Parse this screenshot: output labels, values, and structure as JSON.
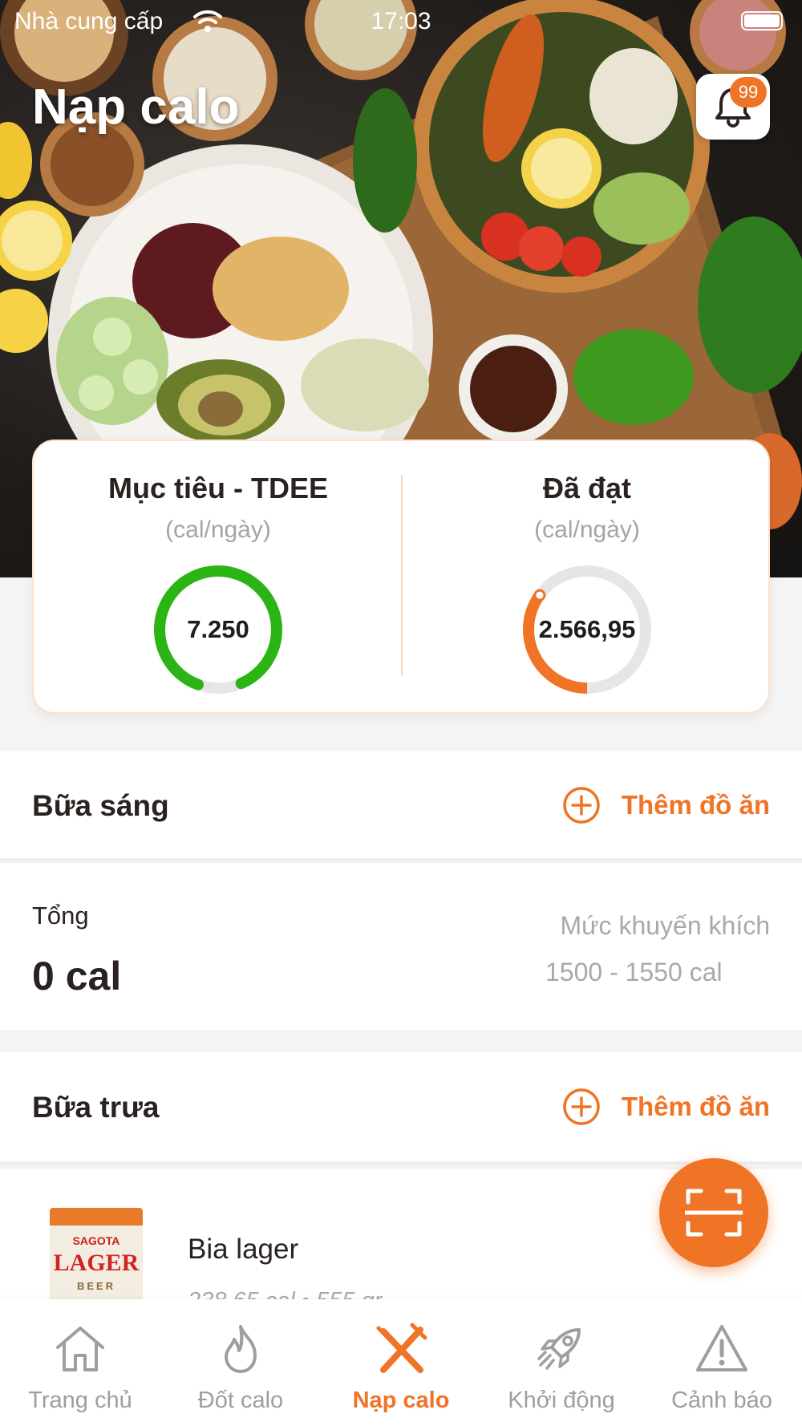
{
  "status_bar": {
    "carrier": "Nhà cung cấp",
    "time": "17:03"
  },
  "header": {
    "title": "Nạp calo",
    "notification_count": "99"
  },
  "summary": {
    "goal": {
      "title": "Mục tiêu - TDEE",
      "unit": "(cal/ngày)",
      "value": "7.250",
      "progress": 0.88,
      "color": "#2bb514"
    },
    "achieved": {
      "title": "Đã đạt",
      "unit": "(cal/ngày)",
      "value": "2.566,95",
      "progress": 0.35,
      "color": "#f07426"
    }
  },
  "breakfast": {
    "title": "Bữa sáng",
    "add_label": "Thêm đồ ăn",
    "total_label": "Tổng",
    "total_value": "0 cal",
    "recommended_label": "Mức khuyến khích",
    "recommended_range": "1500 - 1550 cal"
  },
  "lunch": {
    "title": "Bữa trưa",
    "add_label": "Thêm đồ ăn",
    "items": [
      {
        "name": "Bia lager",
        "meta": "238,65 cal • 555 gr",
        "brand": "SAGOTA",
        "label_main": "LAGER",
        "label_sub": "BEER"
      }
    ]
  },
  "tabs": [
    {
      "label": "Trang chủ",
      "icon": "home-icon",
      "active": false
    },
    {
      "label": "Đốt calo",
      "icon": "flame-icon",
      "active": false
    },
    {
      "label": "Nạp calo",
      "icon": "fork-knife-icon",
      "active": true
    },
    {
      "label": "Khởi động",
      "icon": "rocket-icon",
      "active": false
    },
    {
      "label": "Cảnh báo",
      "icon": "warning-icon",
      "active": false
    }
  ],
  "colors": {
    "accent": "#f07426",
    "goal_ring": "#2bb514",
    "ring_track": "#e6e6e6"
  }
}
